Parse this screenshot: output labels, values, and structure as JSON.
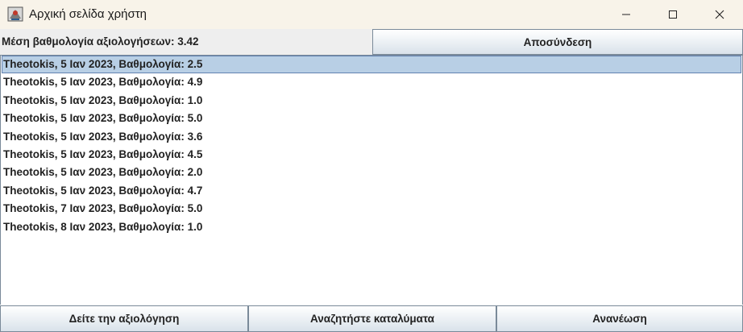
{
  "window": {
    "title": "Αρχική σελίδα χρήστη",
    "controls": [
      "minimize-icon",
      "maximize-icon",
      "close-icon"
    ]
  },
  "header": {
    "average_label": "Μέση βαθμολογία αξιολογήσεων: 3.42",
    "logout_label": "Αποσύνδεση"
  },
  "reviews": {
    "selected_index": 0,
    "items": [
      "Theotokis, 5 Ιαν 2023, Βαθμολογία: 2.5",
      "Theotokis, 5 Ιαν 2023, Βαθμολογία: 4.9",
      "Theotokis, 5 Ιαν 2023, Βαθμολογία: 1.0",
      "Theotokis, 5 Ιαν 2023, Βαθμολογία: 5.0",
      "Theotokis, 5 Ιαν 2023, Βαθμολογία: 3.6",
      "Theotokis, 5 Ιαν 2023, Βαθμολογία: 4.5",
      "Theotokis, 5 Ιαν 2023, Βαθμολογία: 2.0",
      "Theotokis, 5 Ιαν 2023, Βαθμολογία: 4.7",
      "Theotokis, 7 Ιαν 2023, Βαθμολογία: 5.0",
      "Theotokis, 8 Ιαν 2023, Βαθμολογία: 1.0"
    ]
  },
  "footer": {
    "view_review_label": "Δείτε την αξιολόγηση",
    "search_label": "Αναζητήστε καταλύματα",
    "refresh_label": "Ανανέωση"
  },
  "colors": {
    "titlebar_bg": "#f8f3e9",
    "selection_bg": "#b8cfe5",
    "selection_border": "#6382b0",
    "panel_bg": "#eeeeee"
  }
}
